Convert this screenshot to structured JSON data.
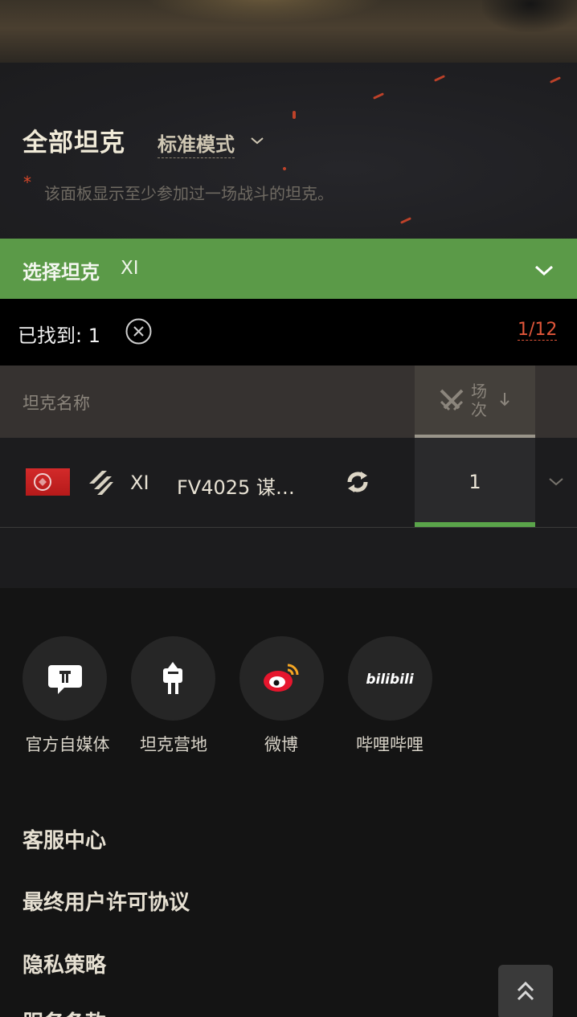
{
  "header": {
    "title": "全部坦克",
    "mode_select": "标准模式",
    "hint_asterisk": "*",
    "hint": "该面板显示至少参加过一场战斗的坦克。"
  },
  "filter": {
    "label": "选择坦克",
    "value": "XI"
  },
  "results": {
    "found_label": "已找到: 1",
    "page_counter": "1/12"
  },
  "table": {
    "columns": {
      "name": "坦克名称",
      "battles": "场次"
    },
    "rows": [
      {
        "tier": "XI",
        "name": "FV4025 谋…",
        "battles": "1"
      }
    ]
  },
  "footer": {
    "social": [
      {
        "label": "官方自媒体",
        "icon": "wot-chat-icon"
      },
      {
        "label": "坦克营地",
        "icon": "tank-camp-icon"
      },
      {
        "label": "微博",
        "icon": "weibo-icon"
      },
      {
        "label": "哔哩哔哩",
        "icon": "bilibili-icon"
      }
    ],
    "links": [
      "客服中心",
      "最终用户许可协议",
      "隐私策略",
      "服务条款"
    ]
  },
  "colors": {
    "accent_green": "#5b9a48",
    "accent_red": "#e0563a",
    "background": "#1a1a1b"
  }
}
